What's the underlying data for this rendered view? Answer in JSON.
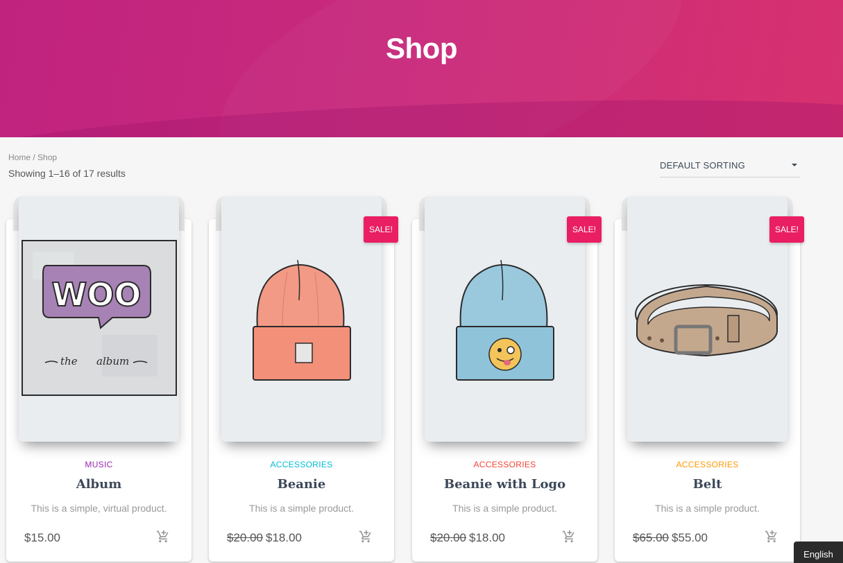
{
  "header": {
    "title": "Shop"
  },
  "breadcrumb": {
    "home": "Home",
    "separator": " / ",
    "current": "Shop"
  },
  "result_count": "Showing 1–16 of 17 results",
  "sorting": {
    "selected": "DEFAULT SORTING"
  },
  "products": [
    {
      "category": "MUSIC",
      "category_color": "#9c27b0",
      "title": "Album",
      "description": "This is a simple, virtual product.",
      "price": "$15.00",
      "old_price": "",
      "sale_badge": "",
      "image_icon": "woo-album-icon"
    },
    {
      "category": "ACCESSORIES",
      "category_color": "#00bcd4",
      "title": "Beanie",
      "description": "This is a simple product.",
      "price": "$18.00",
      "old_price": "$20.00",
      "sale_badge": "SALE!",
      "image_icon": "beanie-icon"
    },
    {
      "category": "ACCESSORIES",
      "category_color": "#f44336",
      "title": "Beanie with Logo",
      "description": "This is a simple product.",
      "price": "$18.00",
      "old_price": "$20.00",
      "sale_badge": "SALE!",
      "image_icon": "beanie-logo-icon"
    },
    {
      "category": "ACCESSORIES",
      "category_color": "#ff9800",
      "title": "Belt",
      "description": "This is a simple product.",
      "price": "$55.00",
      "old_price": "$65.00",
      "sale_badge": "SALE!",
      "image_icon": "belt-icon"
    }
  ],
  "language_switcher": "English",
  "colors": {
    "hero": "#c8287d",
    "sale": "#e91e63"
  }
}
